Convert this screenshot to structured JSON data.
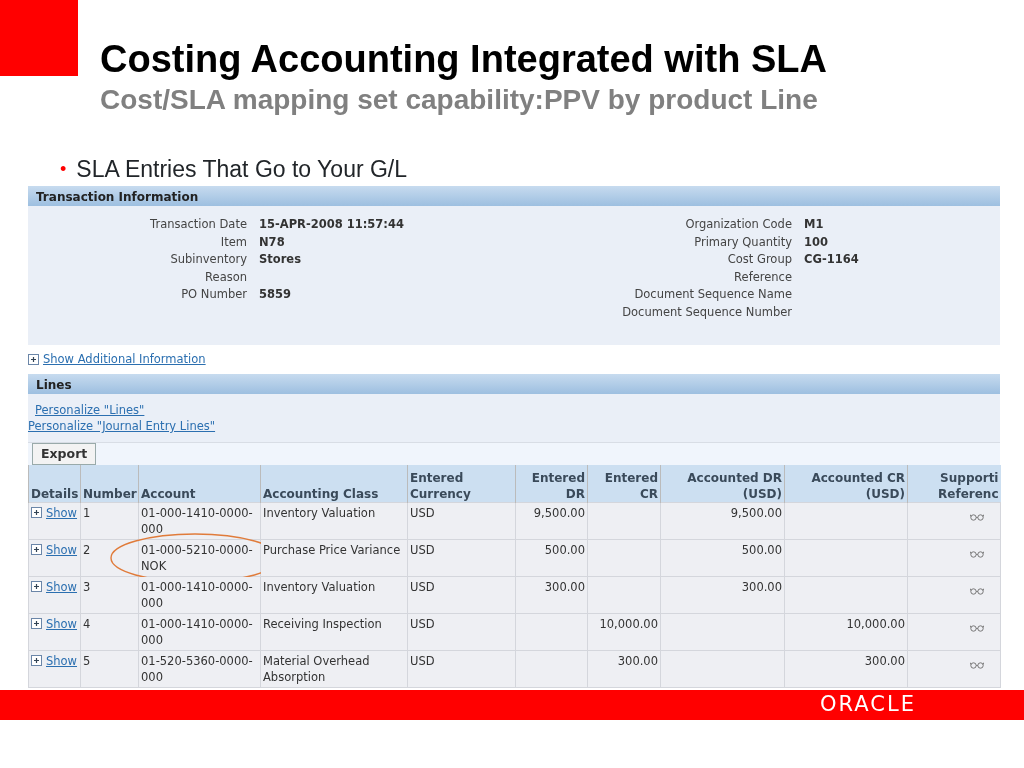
{
  "slide": {
    "title": "Costing Accounting Integrated with SLA",
    "subtitle": "Cost/SLA mapping set capability:PPV by product Line",
    "bullet_marker": "•",
    "bullet": "SLA Entries That Go to Your G/L",
    "footer_logo": "ORACLE"
  },
  "transaction_information": {
    "header": "Transaction Information",
    "left_fields": [
      {
        "label": "Transaction Date",
        "value": "15-APR-2008 11:57:44"
      },
      {
        "label": "Item",
        "value": "N78"
      },
      {
        "label": "Subinventory",
        "value": "Stores"
      },
      {
        "label": "Reason"
      },
      {
        "label": "PO Number",
        "value": "5859"
      }
    ],
    "right_fields": [
      {
        "label": "Organization Code",
        "value": "M1"
      },
      {
        "label": "Primary Quantity",
        "value": "100"
      },
      {
        "label": "Cost Group",
        "value": "CG-1164"
      },
      {
        "label": "Reference"
      },
      {
        "label": "Document Sequence Name"
      },
      {
        "label": "Document Sequence Number"
      }
    ]
  },
  "show_additional_information": "Show Additional Information",
  "lines": {
    "header": "Lines",
    "personalize_links": [
      "Personalize \"Lines\"",
      "Personalize \"Journal Entry Lines\""
    ],
    "export_button": "Export",
    "columns": [
      "Details",
      "Number",
      "Account",
      "Accounting Class",
      "Entered Currency",
      "Entered DR",
      "Entered CR",
      "Accounted DR (USD)",
      "Accounted CR (USD)",
      "Supporti Referenc"
    ],
    "rows": [
      {
        "details": "Show",
        "number": "1",
        "account": "01-000-1410-0000-000",
        "accounting_class": "Inventory Valuation",
        "currency": "USD",
        "entered_dr": "9,500.00",
        "entered_cr": "",
        "accounted_dr": "9,500.00",
        "accounted_cr": "",
        "circled": false
      },
      {
        "details": "Show",
        "number": "2",
        "account": "01-000-5210-0000-NOK",
        "accounting_class": "Purchase Price Variance",
        "currency": "USD",
        "entered_dr": "500.00",
        "entered_cr": "",
        "accounted_dr": "500.00",
        "accounted_cr": "",
        "circled": true
      },
      {
        "details": "Show",
        "number": "3",
        "account": "01-000-1410-0000-000",
        "accounting_class": "Inventory Valuation",
        "currency": "USD",
        "entered_dr": "300.00",
        "entered_cr": "",
        "accounted_dr": "300.00",
        "accounted_cr": "",
        "circled": false
      },
      {
        "details": "Show",
        "number": "4",
        "account": "01-000-1410-0000-000",
        "accounting_class": "Receiving Inspection",
        "currency": "USD",
        "entered_dr": "",
        "entered_cr": "10,000.00",
        "accounted_dr": "",
        "accounted_cr": "10,000.00",
        "circled": false
      },
      {
        "details": "Show",
        "number": "5",
        "account": "01-520-5360-0000-000",
        "accounting_class": "Material Overhead Absorption",
        "currency": "USD",
        "entered_dr": "",
        "entered_cr": "300.00",
        "accounted_dr": "",
        "accounted_cr": "300.00",
        "circled": false
      }
    ]
  }
}
